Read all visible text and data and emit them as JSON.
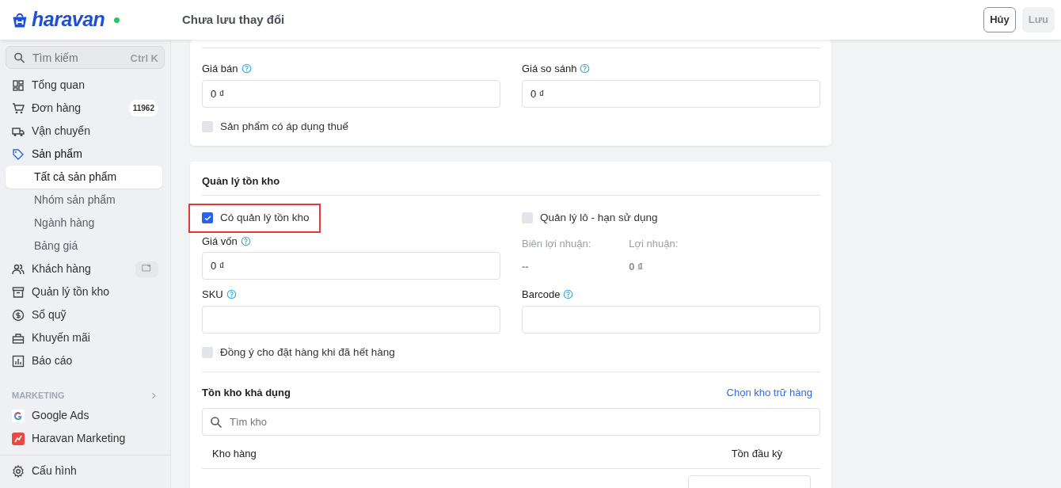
{
  "header": {
    "logo": "haravan",
    "online": true,
    "title": "Chưa lưu thay đổi",
    "buttons": [
      {
        "label": "Hủy",
        "disabled": false
      },
      {
        "label": "Lưu",
        "disabled": true
      }
    ]
  },
  "sidebar": {
    "search": {
      "placeholder": "Tìm kiếm",
      "shortcut": "Ctrl K"
    },
    "items": [
      {
        "label": "Tổng quan",
        "kind": "grid"
      },
      {
        "label": "Đơn hàng",
        "kind": "cart",
        "badge": "11962"
      },
      {
        "label": "Vận chuyển",
        "kind": "truck"
      },
      {
        "label": "Sản phẩm",
        "kind": "tag",
        "expanded": true,
        "children": [
          {
            "label": "Tất cả sản phẩm",
            "selected": true
          },
          {
            "label": "Nhóm sản phẩm",
            "selected": false
          },
          {
            "label": "Ngành hàng",
            "selected": false
          },
          {
            "label": "Bảng giá",
            "selected": false
          }
        ]
      },
      {
        "label": "Khách hàng",
        "kind": "users",
        "trailing_action": true
      },
      {
        "label": "Quản lý tồn kho",
        "kind": "archive"
      },
      {
        "label": "Sổ quỹ",
        "kind": "coin"
      },
      {
        "label": "Khuyến mãi",
        "kind": "gift"
      },
      {
        "label": "Báo cáo",
        "kind": "chart"
      }
    ],
    "section": {
      "title": "MARKETING",
      "items": [
        {
          "label": "Google Ads",
          "kind": "google"
        },
        {
          "label": "Haravan Marketing",
          "kind": "hmkt"
        }
      ]
    },
    "footer_items": [
      {
        "label": "Cấu hình",
        "kind": "gear"
      }
    ]
  },
  "price_card": {
    "fields": [
      {
        "label": "Giá bán",
        "value": "0 ₫"
      },
      {
        "label": "Giá so sánh",
        "value": "0 ₫"
      }
    ],
    "checkboxes": [
      {
        "label": "Sản phẩm có áp dụng thuế",
        "checked": false
      }
    ]
  },
  "inventory_card": {
    "title": "Quản lý tồn kho",
    "options": [
      {
        "label": "Có quản lý tồn kho",
        "checked": true,
        "highlighted": true
      },
      {
        "label": "Quản lý lô - hạn sử dụng",
        "checked": false,
        "highlighted": false
      }
    ],
    "cost": {
      "label": "Giá vốn",
      "value": "0 ₫"
    },
    "stats": [
      {
        "label": "Biên lợi nhuận:",
        "value": "--"
      },
      {
        "label": "Lợi nhuận:",
        "value": "0 ₫"
      }
    ],
    "codes": [
      {
        "label": "SKU"
      },
      {
        "label": "Barcode"
      }
    ],
    "backorder": {
      "label": "Đồng ý cho đặt hàng khi đã hết hàng",
      "checked": false
    },
    "stock": {
      "title": "Tồn kho khả dụng",
      "link": "Chọn kho trữ hàng",
      "search_placeholder": "Tìm kho",
      "columns": [
        "Kho hàng",
        "Tồn đầu kỳ"
      ]
    }
  }
}
